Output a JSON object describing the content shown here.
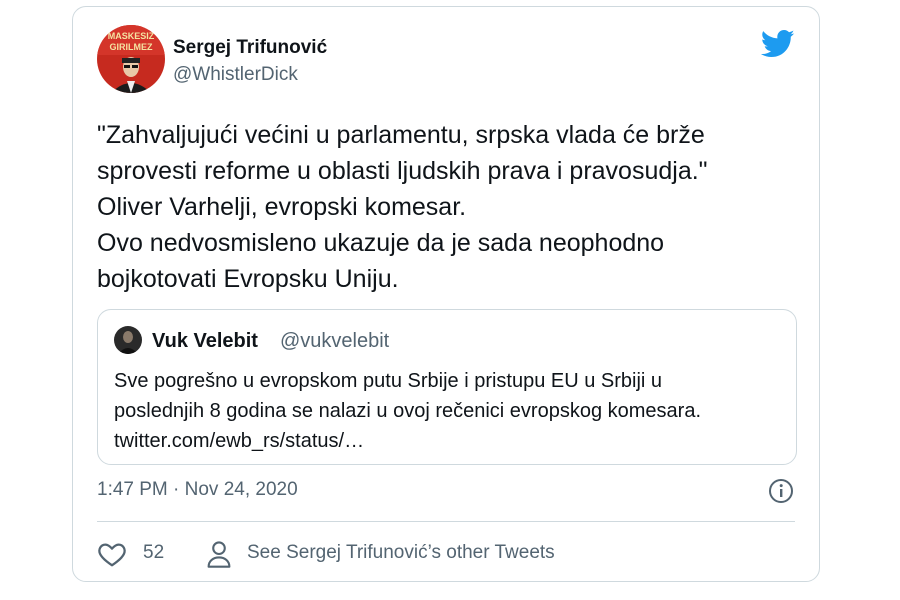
{
  "author": {
    "name": "Sergej Trifunović",
    "handle": "@WhistlerDick",
    "avatar_text": [
      "MASKESIZ",
      "GIRILMEZ"
    ]
  },
  "tweet": {
    "lines": [
      "\"Zahvaljujući većini u parlamentu, srpska vlada će brže",
      "sprovesti reforme u oblasti ljudskih prava i pravosudja.\"",
      "Oliver Varhelji, evropski komesar.",
      "Ovo nedvosmisleno ukazuje da je sada neophodno",
      "bojkotovati Evropsku Uniju."
    ],
    "timestamp": "1:47 PM · Nov 24, 2020"
  },
  "quoted": {
    "name": "Vuk Velebit",
    "handle": "@vukvelebit",
    "lines": [
      "Sve pogrešno u evropskom putu Srbije i pristupu EU u Srbiji u",
      "poslednjih 8 godina se nalazi u ovoj rečenici evropskog komesara.",
      "twitter.com/ewb_rs/status/…"
    ]
  },
  "actions": {
    "like_count": "52",
    "see_more_label": "See Sergej Trifunović’s other Tweets"
  },
  "icons": {
    "brand": "twitter-bird-icon",
    "info": "info-icon",
    "like": "heart-icon",
    "profile": "person-icon"
  },
  "colors": {
    "accent": "#1d9bf0",
    "secondary_text": "#536471",
    "border": "#cfd9de"
  }
}
